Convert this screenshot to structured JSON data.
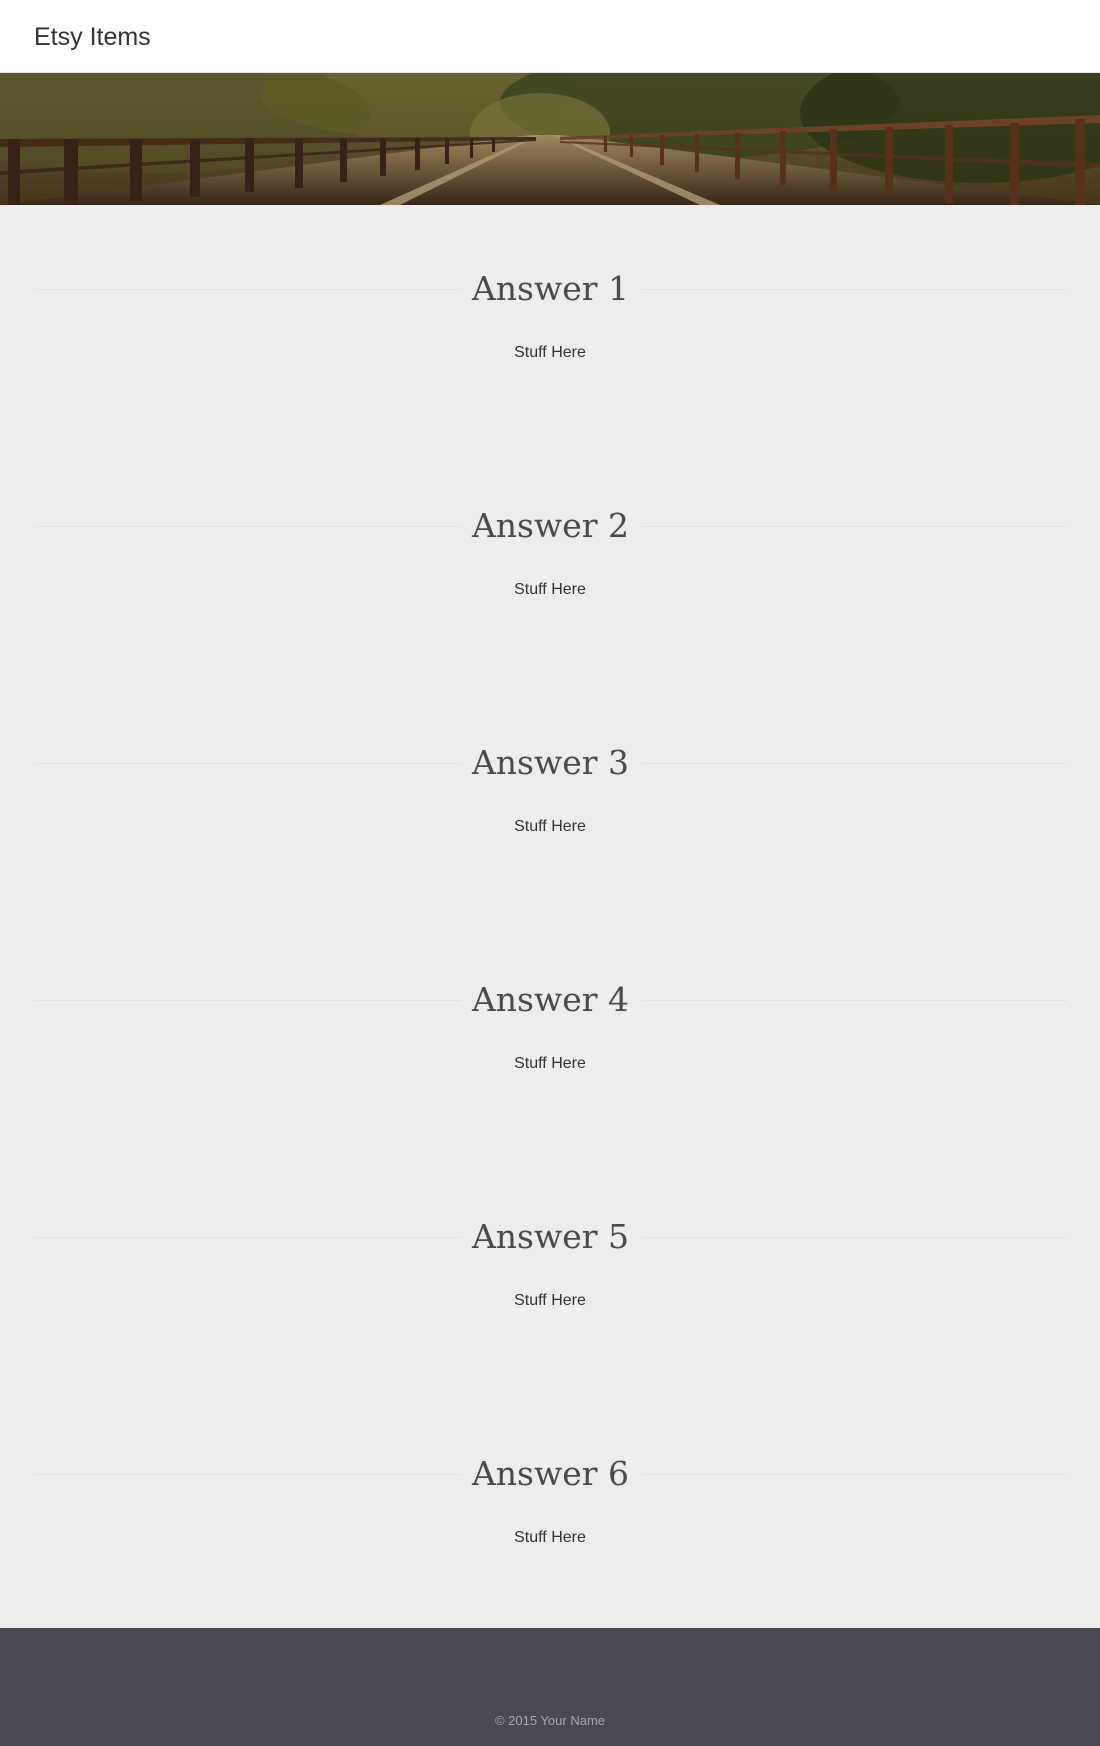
{
  "header": {
    "brand": "Etsy Items"
  },
  "sections": [
    {
      "title": "Answer 1",
      "text": "Stuff Here"
    },
    {
      "title": "Answer 2",
      "text": "Stuff Here"
    },
    {
      "title": "Answer 3",
      "text": "Stuff Here"
    },
    {
      "title": "Answer 4",
      "text": "Stuff Here"
    },
    {
      "title": "Answer 5",
      "text": "Stuff Here"
    },
    {
      "title": "Answer 6",
      "text": "Stuff Here"
    }
  ],
  "footer": {
    "copyright": "© 2015 Your Name"
  },
  "colors": {
    "page_background": "#ededed",
    "header_background": "#ffffff",
    "footer_background": "#4a4850",
    "footer_text": "#a9a7ae",
    "heading_text": "#4a4a4a"
  }
}
